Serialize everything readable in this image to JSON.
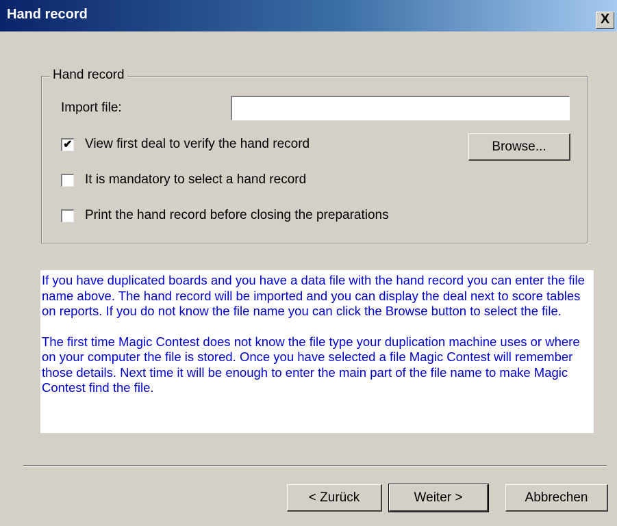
{
  "window": {
    "title": "Hand record",
    "close_glyph": "X"
  },
  "group": {
    "legend": "Hand record",
    "import_label": "Import file:",
    "import_value": "",
    "browse_label": "Browse...",
    "checkboxes": [
      {
        "label": "View first deal to verify the hand record",
        "checked": true,
        "mark": "✔"
      },
      {
        "label": "It is mandatory to select a hand record",
        "checked": false,
        "mark": ""
      },
      {
        "label": "Print the hand record before closing the preparations",
        "checked": false,
        "mark": ""
      }
    ]
  },
  "info": {
    "paragraphs": [
      "If you have duplicated boards and you have a data file with the hand record you can enter the file name above. The hand record will be imported and you can display the deal next to score tables on reports. If you do not know the file name you can click the Browse button to select the file.",
      "The first time Magic Contest does not know the file type your duplication machine uses or where on your computer the file is stored. Once you have selected a file Magic Contest will remember those details. Next time it will be enough to enter the main part of the file name to make Magic Contest find the file."
    ]
  },
  "buttons": {
    "back": "< Zurück",
    "next": "Weiter >",
    "cancel": "Abbrechen"
  },
  "colors": {
    "title_start": "#0a246a",
    "title_end": "#a6caf0",
    "dialog_bg": "#d4d0c8",
    "info_text": "#0000cc"
  }
}
